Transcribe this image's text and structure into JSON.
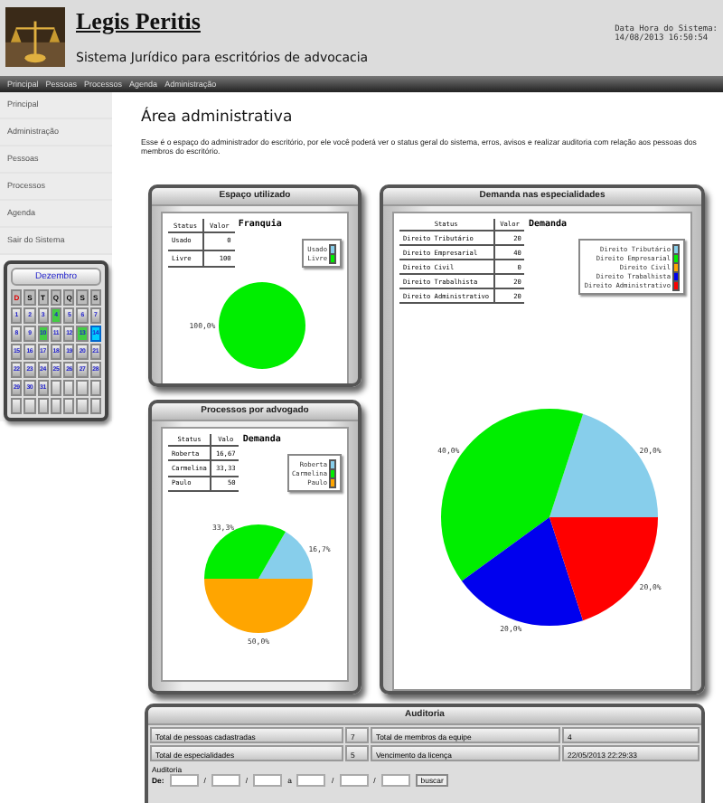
{
  "header": {
    "title": "Legis Peritis",
    "subtitle": "Sistema Jurídico para escritórios de advocacia",
    "clock_label": "Data Hora do Sistema:",
    "clock_value": "14/08/2013 16:50:54"
  },
  "nav": [
    "Principal",
    "Pessoas",
    "Processos",
    "Agenda",
    "Administração"
  ],
  "sidebar": {
    "items": [
      "Principal",
      "Administração",
      "Pessoas",
      "Processos",
      "Agenda",
      "Sair do Sistema"
    ]
  },
  "calendar": {
    "month": "Dezembro",
    "weekdays": [
      {
        "label": "D",
        "highlighted": true
      },
      {
        "label": "S",
        "highlighted": false
      },
      {
        "label": "T",
        "highlighted": false
      },
      {
        "label": "Q",
        "highlighted": false
      },
      {
        "label": "Q",
        "highlighted": false
      },
      {
        "label": "S",
        "highlighted": false
      },
      {
        "label": "S",
        "highlighted": false
      }
    ],
    "days": [
      {
        "kind": "day",
        "label": "1",
        "marked": false,
        "selected": false
      },
      {
        "kind": "day",
        "label": "2",
        "marked": false,
        "selected": false
      },
      {
        "kind": "day",
        "label": "3",
        "marked": false,
        "selected": false
      },
      {
        "kind": "day",
        "label": "4",
        "marked": true,
        "selected": false
      },
      {
        "kind": "day",
        "label": "5",
        "marked": false,
        "selected": false
      },
      {
        "kind": "day",
        "label": "6",
        "marked": false,
        "selected": false
      },
      {
        "kind": "day",
        "label": "7",
        "marked": false,
        "selected": false
      },
      {
        "kind": "day",
        "label": "8",
        "marked": false,
        "selected": false
      },
      {
        "kind": "day",
        "label": "9",
        "marked": false,
        "selected": false
      },
      {
        "kind": "day",
        "label": "10",
        "marked": true,
        "selected": false
      },
      {
        "kind": "day",
        "label": "11",
        "marked": false,
        "selected": false
      },
      {
        "kind": "day",
        "label": "12",
        "marked": false,
        "selected": false
      },
      {
        "kind": "day",
        "label": "13",
        "marked": true,
        "selected": false
      },
      {
        "kind": "day",
        "label": "14",
        "marked": false,
        "selected": true
      },
      {
        "kind": "day",
        "label": "15",
        "marked": false,
        "selected": false
      },
      {
        "kind": "day",
        "label": "16",
        "marked": false,
        "selected": false
      },
      {
        "kind": "day",
        "label": "17",
        "marked": false,
        "selected": false
      },
      {
        "kind": "day",
        "label": "18",
        "marked": false,
        "selected": false
      },
      {
        "kind": "day",
        "label": "19",
        "marked": false,
        "selected": false
      },
      {
        "kind": "day",
        "label": "20",
        "marked": false,
        "selected": false
      },
      {
        "kind": "day",
        "label": "21",
        "marked": false,
        "selected": false
      },
      {
        "kind": "day",
        "label": "22",
        "marked": false,
        "selected": false
      },
      {
        "kind": "day",
        "label": "23",
        "marked": false,
        "selected": false
      },
      {
        "kind": "day",
        "label": "24",
        "marked": false,
        "selected": false
      },
      {
        "kind": "day",
        "label": "25",
        "marked": false,
        "selected": false
      },
      {
        "kind": "day",
        "label": "26",
        "marked": false,
        "selected": false
      },
      {
        "kind": "day",
        "label": "27",
        "marked": false,
        "selected": false
      },
      {
        "kind": "day",
        "label": "28",
        "marked": false,
        "selected": false
      },
      {
        "kind": "day",
        "label": "29",
        "marked": false,
        "selected": false
      },
      {
        "kind": "day",
        "label": "30",
        "marked": false,
        "selected": false
      },
      {
        "kind": "day",
        "label": "31",
        "marked": false,
        "selected": false
      },
      {
        "kind": "empty"
      },
      {
        "kind": "empty"
      },
      {
        "kind": "empty"
      },
      {
        "kind": "empty"
      },
      {
        "kind": "empty"
      },
      {
        "kind": "empty"
      },
      {
        "kind": "empty"
      },
      {
        "kind": "empty"
      },
      {
        "kind": "empty"
      },
      {
        "kind": "empty"
      },
      {
        "kind": "empty"
      }
    ]
  },
  "main": {
    "title": "Área administrativa",
    "description": "Esse é o espaço do administrador do escritório, por ele você poderá ver o status geral do sistema, erros, avisos e realizar auditoria com relação aos pessoas dos membros do escritório."
  },
  "panels": [
    {
      "title": "Espaço utilizado",
      "table": {
        "columns": [
          "Status",
          "Valor"
        ],
        "rows": [
          [
            "Usado",
            "0"
          ],
          [
            "Livre",
            "100"
          ]
        ]
      },
      "chart_data": {
        "type": "pie",
        "title": "Franquia",
        "categories": [
          "Usado",
          "Livre"
        ],
        "values": [
          0,
          100
        ],
        "colors": [
          "#87ceeb",
          "#00ee00"
        ],
        "value_labels": [
          null,
          "100,0%"
        ]
      }
    },
    {
      "title": "Demanda nas especialidades",
      "table": {
        "columns": [
          "Status",
          "Valor"
        ],
        "rows": [
          [
            "Direito Tributário",
            "20"
          ],
          [
            "Direito Empresarial",
            "40"
          ],
          [
            "Direito Civil",
            "0"
          ],
          [
            "Direito Trabalhista",
            "20"
          ],
          [
            "Direito Administrativo",
            "20"
          ]
        ]
      },
      "chart_data": {
        "type": "pie",
        "title": "Demanda",
        "categories": [
          "Direito Tributário",
          "Direito Empresarial",
          "Direito Civil",
          "Direito Trabalhista",
          "Direito Administrativo"
        ],
        "values": [
          20,
          40,
          0,
          20,
          20
        ],
        "colors": [
          "#87ceeb",
          "#00ee00",
          "#ffa500",
          "#0000ee",
          "#ff0000"
        ],
        "value_labels": [
          "20,0%",
          "40,0%",
          null,
          "20,0%",
          "20,0%"
        ]
      }
    },
    {
      "title": "Processos por advogado",
      "table": {
        "columns": [
          "Status",
          "Valo"
        ],
        "rows": [
          [
            "Roberta",
            "16,67"
          ],
          [
            "Carmelina",
            "33,33"
          ],
          [
            "Paulo",
            "50"
          ]
        ]
      },
      "chart_data": {
        "type": "pie",
        "title": "Demanda",
        "categories": [
          "Roberta",
          "Carmelina",
          "Paulo"
        ],
        "values": [
          16.67,
          33.33,
          50
        ],
        "colors": [
          "#87ceeb",
          "#00ee00",
          "#ffa500"
        ],
        "value_labels": [
          "16,7%",
          "33,3%",
          "50,0%"
        ]
      }
    }
  ],
  "audit": {
    "title": "Auditoria",
    "rows": [
      [
        "Total de pessoas cadastradas",
        "7",
        "Total de membros da equipe",
        "4"
      ],
      [
        "Total de especialidades",
        "5",
        "Vencimento da licença",
        "22/05/2013 22:29:33"
      ]
    ],
    "filter_label": "Auditoria",
    "filter": [
      {
        "kind": "label",
        "text": "De:"
      },
      {
        "kind": "input"
      },
      {
        "kind": "sep",
        "text": "/"
      },
      {
        "kind": "input"
      },
      {
        "kind": "sep",
        "text": "/"
      },
      {
        "kind": "input"
      },
      {
        "kind": "sep",
        "text": "a"
      },
      {
        "kind": "input"
      },
      {
        "kind": "sep",
        "text": "/"
      },
      {
        "kind": "input"
      },
      {
        "kind": "sep",
        "text": "/"
      },
      {
        "kind": "input"
      },
      {
        "kind": "button",
        "text": "buscar"
      }
    ]
  }
}
